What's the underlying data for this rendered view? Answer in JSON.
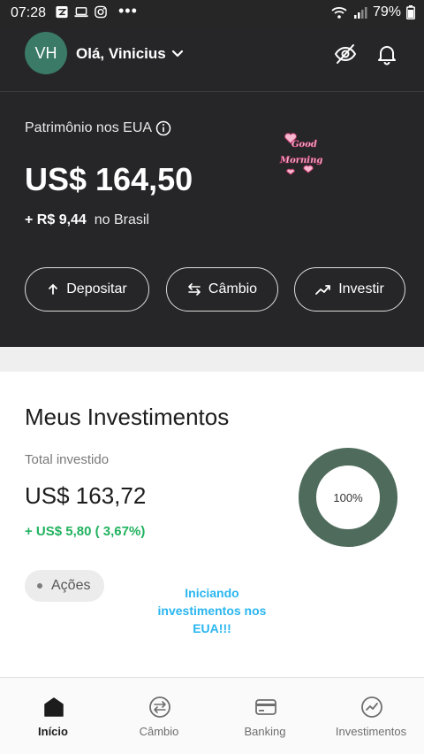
{
  "status_bar": {
    "time": "07:28",
    "battery": "79%"
  },
  "header": {
    "avatar_initials": "VH",
    "greeting": "Olá, Vinicius",
    "patrimonio_label": "Patrimônio nos EUA",
    "balance": "US$ 164,50",
    "brazil_amount": "+ R$ 9,44",
    "brazil_suffix": "no Brasil",
    "sticker_text": "Good Morning!"
  },
  "actions": {
    "deposit": "Depositar",
    "exchange": "Câmbio",
    "invest": "Investir"
  },
  "investments": {
    "title": "Meus Investimentos",
    "total_label": "Total investido",
    "total_value": "US$ 163,72",
    "gain": "+ US$ 5,80 ( 3,67%)",
    "chip": "Ações",
    "donut_label": "100%",
    "promo_text": "Iniciando investimentos nos EUA!!!"
  },
  "chart_data": {
    "type": "pie",
    "categories": [
      "Ações"
    ],
    "values": [
      100
    ],
    "title": ""
  },
  "colors": {
    "header_bg": "#262628",
    "avatar": "#3a7a66",
    "donut": "#4f6b5c",
    "gain": "#20b25e",
    "promo": "#29b6f0"
  },
  "bottom_nav": {
    "items": [
      {
        "label": "Início",
        "icon": "home-icon"
      },
      {
        "label": "Câmbio",
        "icon": "exchange-icon"
      },
      {
        "label": "Banking",
        "icon": "card-icon"
      },
      {
        "label": "Investimentos",
        "icon": "chart-icon"
      }
    ]
  }
}
